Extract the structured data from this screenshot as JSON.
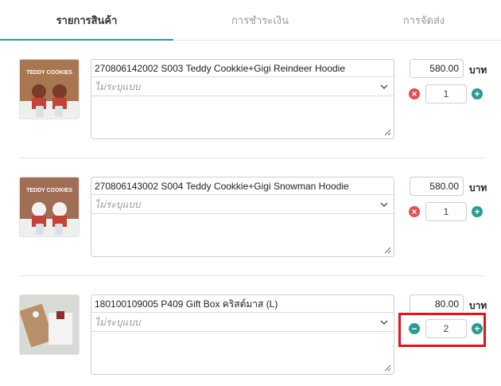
{
  "tabs": [
    {
      "label": "รายการสินค้า",
      "active": true
    },
    {
      "label": "การชำระเงิน",
      "active": false
    },
    {
      "label": "การจัดส่ง",
      "active": false
    }
  ],
  "currency_unit": "บาท",
  "items": [
    {
      "name": "270806142002 S003 Teddy Cookkie+Gigi Reindeer Hoodie",
      "variant_placeholder": "ไม่ระบุแบบ",
      "price": "580.00",
      "quantity": "1",
      "decrease_icon": "remove-icon",
      "increase_icon": "add-icon",
      "image_caption": "TEDDY COOKIES"
    },
    {
      "name": "270806143002 S004 Teddy Cookkie+Gigi Snowman Hoodie",
      "variant_placeholder": "ไม่ระบุแบบ",
      "price": "580.00",
      "quantity": "1",
      "decrease_icon": "remove-icon",
      "increase_icon": "add-icon",
      "image_caption": "TEDDY COOKIES"
    },
    {
      "name": "180100109005 P409 Gift Box คริสต์มาส (L)",
      "variant_placeholder": "ไม่ระบุแบบ",
      "price": "80.00",
      "quantity": "2",
      "decrease_icon": "minus-icon",
      "increase_icon": "add-icon",
      "image_caption": ""
    }
  ],
  "colors": {
    "accent": "#2a9d8f",
    "remove": "#e44e4e",
    "highlight": "#e0151b"
  }
}
